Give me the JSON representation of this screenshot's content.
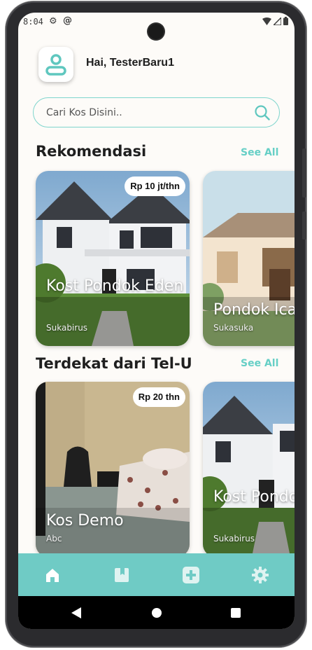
{
  "status_bar": {
    "time": "8:04",
    "gear_icon": "gear-icon",
    "at_icon": "at-icon"
  },
  "header": {
    "greeting": "Hai, TesterBaru1",
    "avatar_icon": "user-icon"
  },
  "search": {
    "placeholder": "Cari Kos Disini.."
  },
  "recommendations": {
    "title": "Rekomendasi",
    "see_all": "See All",
    "cards": [
      {
        "name": "Kost Pondok Eden",
        "location": "Sukabirus",
        "price": "Rp 10 jt/thn"
      },
      {
        "name": "Pondok Ica",
        "location": "Sukasuka",
        "price": ""
      }
    ]
  },
  "nearby": {
    "title": "Terdekat dari Tel-U",
    "see_all": "See All",
    "cards": [
      {
        "name": "Kos Demo",
        "location": "Abc",
        "price": "Rp 20 thn"
      },
      {
        "name": "Kost Pondok Eden",
        "location": "Sukabirus",
        "price": ""
      }
    ]
  },
  "bottom_nav": {
    "items": [
      "home-icon",
      "bookmark-icon",
      "add-icon",
      "settings-icon"
    ],
    "active": "home-icon"
  },
  "colors": {
    "accent": "#6fcbc5",
    "see_all": "#66cfc6",
    "background": "#fdfbf8"
  }
}
